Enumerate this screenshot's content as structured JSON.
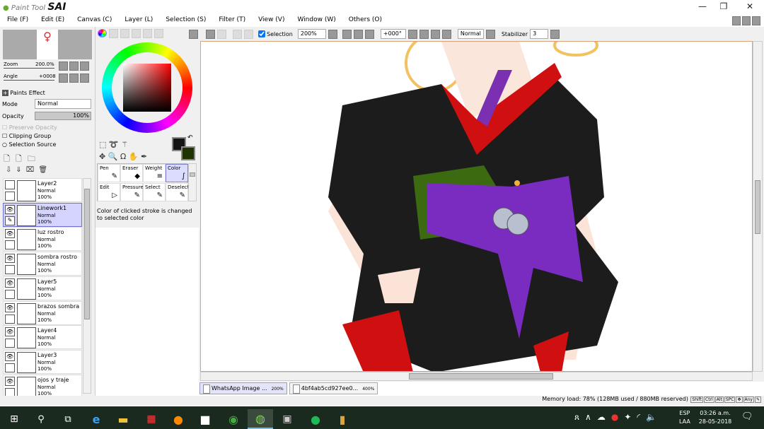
{
  "app": {
    "logo_prefix": "Paint Tool",
    "logo_name": "SAI"
  },
  "window_controls": {
    "minimize": "—",
    "restore": "❐",
    "close": "✕"
  },
  "menu": [
    "File (F)",
    "Edit (E)",
    "Canvas (C)",
    "Layer (L)",
    "Selection (S)",
    "Filter (T)",
    "View (V)",
    "Window (W)",
    "Others (O)"
  ],
  "navigator": {
    "zoom_label": "Zoom",
    "zoom_value": "200.0%",
    "angle_label": "Angle",
    "angle_value": "+0008"
  },
  "layer_props": {
    "paints_effect": "Paints Effect",
    "mode_label": "Mode",
    "mode_value": "Normal",
    "opacity_label": "Opacity",
    "opacity_value": "100%",
    "opacity_fraction": 1.0,
    "preserve_opacity": "Preserve Opacity",
    "clipping_group": "Clipping Group",
    "selection_source": "Selection Source"
  },
  "layers": [
    {
      "name": "Layer2",
      "mode": "Normal",
      "opacity": "100%",
      "visible": false,
      "selected": false
    },
    {
      "name": "Linework1",
      "mode": "Normal",
      "opacity": "100%",
      "visible": true,
      "selected": true
    },
    {
      "name": "luz rostro",
      "mode": "Normal",
      "opacity": "100%",
      "visible": true,
      "selected": false
    },
    {
      "name": "sombra rostro",
      "mode": "Normal",
      "opacity": "100%",
      "visible": true,
      "selected": false
    },
    {
      "name": "Layer5",
      "mode": "Normal",
      "opacity": "100%",
      "visible": true,
      "selected": false
    },
    {
      "name": "brazos sombra",
      "mode": "Normal",
      "opacity": "100%",
      "visible": true,
      "selected": false
    },
    {
      "name": "Layer4",
      "mode": "Normal",
      "opacity": "100%",
      "visible": true,
      "selected": false
    },
    {
      "name": "Layer3",
      "mode": "Normal",
      "opacity": "100%",
      "visible": true,
      "selected": false
    },
    {
      "name": "ojos y traje",
      "mode": "Normal",
      "opacity": "100%",
      "visible": true,
      "selected": false
    }
  ],
  "colors": {
    "primary": "#151515",
    "secondary": "#1f3300",
    "accent": "#7070d0"
  },
  "tools": [
    {
      "label": "Pen",
      "icon": "pen-icon",
      "glyph": "✎"
    },
    {
      "label": "Eraser",
      "icon": "eraser-icon",
      "glyph": "◆"
    },
    {
      "label": "Weight",
      "icon": "weight-icon",
      "glyph": "≡"
    },
    {
      "label": "Color",
      "icon": "color-stroke-icon",
      "glyph": "∫",
      "selected": true
    },
    {
      "label": "Edit",
      "icon": "edit-icon",
      "glyph": "▷"
    },
    {
      "label": "Pressure",
      "icon": "pressure-icon",
      "glyph": "✎"
    },
    {
      "label": "Select",
      "icon": "select-pen-icon",
      "glyph": "✎"
    },
    {
      "label": "Deselect",
      "icon": "deselect-pen-icon",
      "glyph": "✎"
    }
  ],
  "tool_hint": "Color of clicked stroke is changed to selected color",
  "toolbar": {
    "selection_label": "Selection",
    "selection_checked": true,
    "zoom": "200%",
    "angle": "+000°",
    "blend": "Normal",
    "stabilizer_label": "Stabilizer",
    "stabilizer_value": "3"
  },
  "doc_tabs": [
    {
      "name": "WhatsApp Image ...",
      "zoom": "200%",
      "active": true
    },
    {
      "name": "4bf4ab5cd927ee0...",
      "zoom": "400%",
      "active": false
    }
  ],
  "status": {
    "memory": "Memory load: 78% (128MB used / 880MB reserved)",
    "keys": [
      "Shift",
      "Ctrl",
      "Alt",
      "SPC",
      "✥",
      "Any",
      "✎"
    ]
  },
  "taskbar": {
    "lang_top": "ESP",
    "lang_bottom": "LAA",
    "time": "03:26 a.m.",
    "date": "28-05-2018"
  }
}
